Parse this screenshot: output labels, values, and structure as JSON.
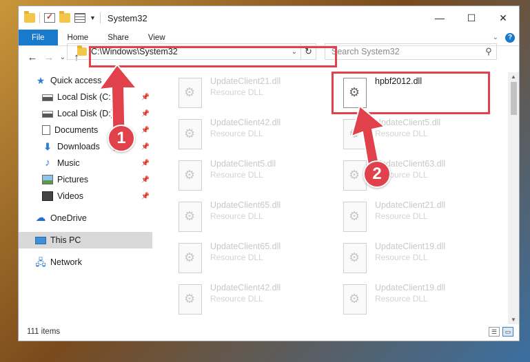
{
  "window": {
    "title": "System32",
    "controls": {
      "minimize": "—",
      "maximize": "☐",
      "close": "✕"
    }
  },
  "ribbon": {
    "tabs": [
      "File",
      "Home",
      "Share",
      "View"
    ],
    "help": "?"
  },
  "nav": {
    "back": "←",
    "forward": "→",
    "recent": "⌄",
    "up": "↑",
    "address": "C:\\Windows\\System32",
    "address_dropdown": "⌄",
    "refresh": "↻",
    "search_placeholder": "Search System32",
    "search_icon": "⚲"
  },
  "sidebar": {
    "quick_access": "Quick access",
    "items": [
      {
        "label": "Local Disk (C:)",
        "icon": "disk-icon"
      },
      {
        "label": "Local Disk (D:)",
        "icon": "disk-icon"
      },
      {
        "label": "Documents",
        "icon": "documents-icon"
      },
      {
        "label": "Downloads",
        "icon": "downloads-icon"
      },
      {
        "label": "Music",
        "icon": "music-icon"
      },
      {
        "label": "Pictures",
        "icon": "pictures-icon"
      },
      {
        "label": "Videos",
        "icon": "videos-icon"
      }
    ],
    "pin_glyph": "📌",
    "onedrive": "OneDrive",
    "this_pc": "This PC",
    "network": "Network"
  },
  "files": {
    "col1": [
      {
        "name": "UpdateClient21.dll",
        "type": "Resource DLL"
      },
      {
        "name": "UpdateClient42.dll",
        "type": "Resource DLL"
      },
      {
        "name": "UpdateClient5.dll",
        "type": "Resource DLL"
      },
      {
        "name": "UpdateClient65.dll",
        "type": "Resource DLL"
      },
      {
        "name": "UpdateClient65.dll",
        "type": "Resource DLL"
      },
      {
        "name": "UpdateClient42.dll",
        "type": "Resource DLL"
      }
    ],
    "highlighted": {
      "name": "hpbf2012.dll"
    },
    "col2": [
      {
        "name": "UpdateClient5.dll",
        "type": "Resource DLL"
      },
      {
        "name": "UpdateClient63.dll",
        "type": "Resource DLL"
      },
      {
        "name": "UpdateClient21.dll",
        "type": "Resource DLL"
      },
      {
        "name": "UpdateClient19.dll",
        "type": "Resource DLL"
      },
      {
        "name": "UpdateClient19.dll",
        "type": "Resource DLL"
      }
    ]
  },
  "status": {
    "item_count": "111 items"
  },
  "annotations": {
    "step1": "1",
    "step2": "2",
    "color": "#e0414b"
  }
}
